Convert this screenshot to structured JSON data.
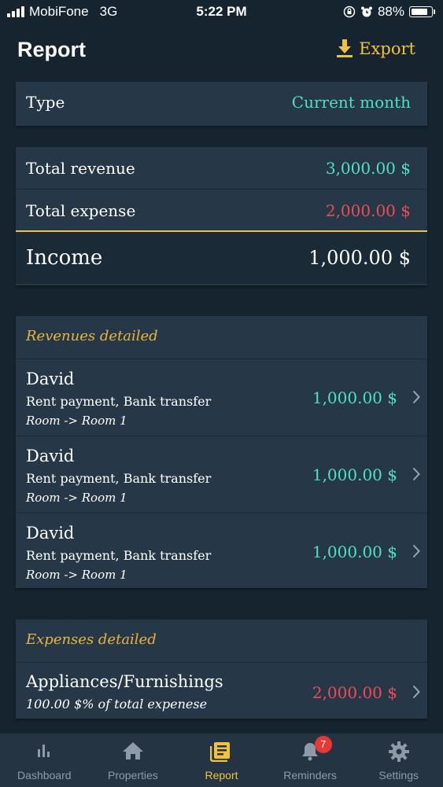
{
  "status_bar": {
    "carrier": "MobiFone",
    "network": "3G",
    "time": "5:22 PM",
    "battery_percent": "88%",
    "battery_level": 0.88
  },
  "header": {
    "title": "Report",
    "export_label": "Export"
  },
  "type_card": {
    "label": "Type",
    "value": "Current month"
  },
  "summary": {
    "revenue_label": "Total revenue",
    "revenue_value": "3,000.00 $",
    "expense_label": "Total expense",
    "expense_value": "2,000.00 $",
    "income_label": "Income",
    "income_value": "1,000.00 $"
  },
  "revenues": {
    "title": "Revenues detailed",
    "items": [
      {
        "name": "David",
        "description": "Rent payment, Bank transfer",
        "room": "Room -> Room 1",
        "amount": "1,000.00 $"
      },
      {
        "name": "David",
        "description": "Rent payment, Bank transfer",
        "room": "Room -> Room 1",
        "amount": "1,000.00 $"
      },
      {
        "name": "David",
        "description": "Rent payment, Bank transfer",
        "room": "Room -> Room 1",
        "amount": "1,000.00 $"
      }
    ]
  },
  "expenses": {
    "title": "Expenses detailed",
    "items": [
      {
        "name": "Appliances/Furnishings",
        "note": "100.00 $% of total expenese",
        "amount": "2,000.00 $"
      }
    ]
  },
  "tabbar": {
    "tabs": [
      {
        "label": "Dashboard",
        "icon": "bar-chart-icon"
      },
      {
        "label": "Properties",
        "icon": "home-icon"
      },
      {
        "label": "Report",
        "icon": "report-icon",
        "active": true
      },
      {
        "label": "Reminders",
        "icon": "bell-icon",
        "badge": "7"
      },
      {
        "label": "Settings",
        "icon": "gear-icon"
      }
    ]
  },
  "colors": {
    "background": "#162430",
    "card": "#263848",
    "accent": "#f2c13d",
    "positive": "#4ee0c5",
    "negative": "#ec4c55",
    "badge": "#e53935"
  }
}
